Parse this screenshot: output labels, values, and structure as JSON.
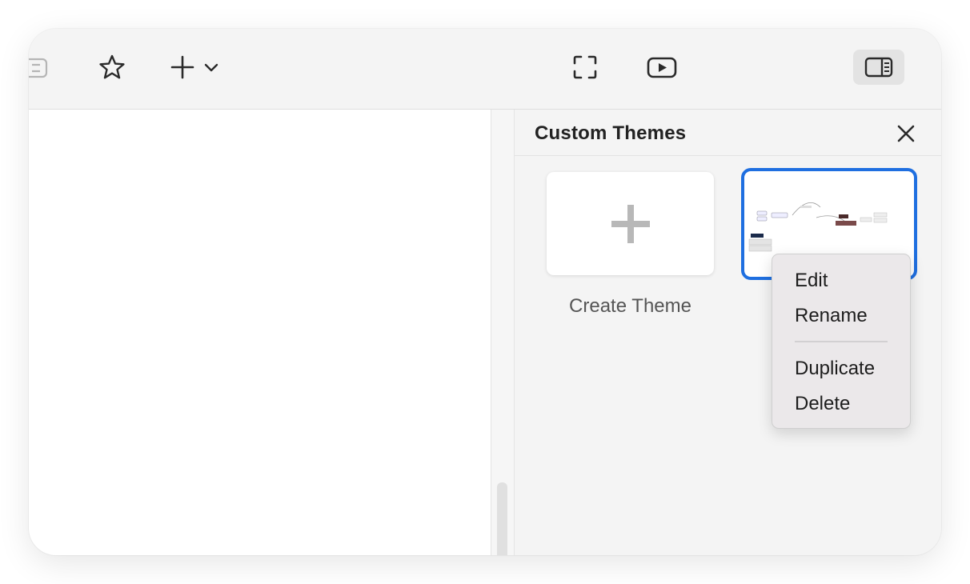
{
  "toolbar": {
    "buttons": [
      {
        "name": "sidebar-toggle-icon"
      },
      {
        "name": "star-icon"
      },
      {
        "name": "add-icon"
      },
      {
        "name": "fullscreen-icon"
      },
      {
        "name": "play-icon"
      },
      {
        "name": "panel-toggle-icon",
        "active": true
      }
    ]
  },
  "panel": {
    "title": "Custom Themes",
    "close_icon": "close-icon",
    "create_label": "Create Theme"
  },
  "context_menu": {
    "items": [
      "Edit",
      "Rename",
      "Duplicate",
      "Delete"
    ]
  },
  "colors": {
    "selection_border": "#1f6fe0",
    "panel_bg": "#f4f4f4"
  }
}
